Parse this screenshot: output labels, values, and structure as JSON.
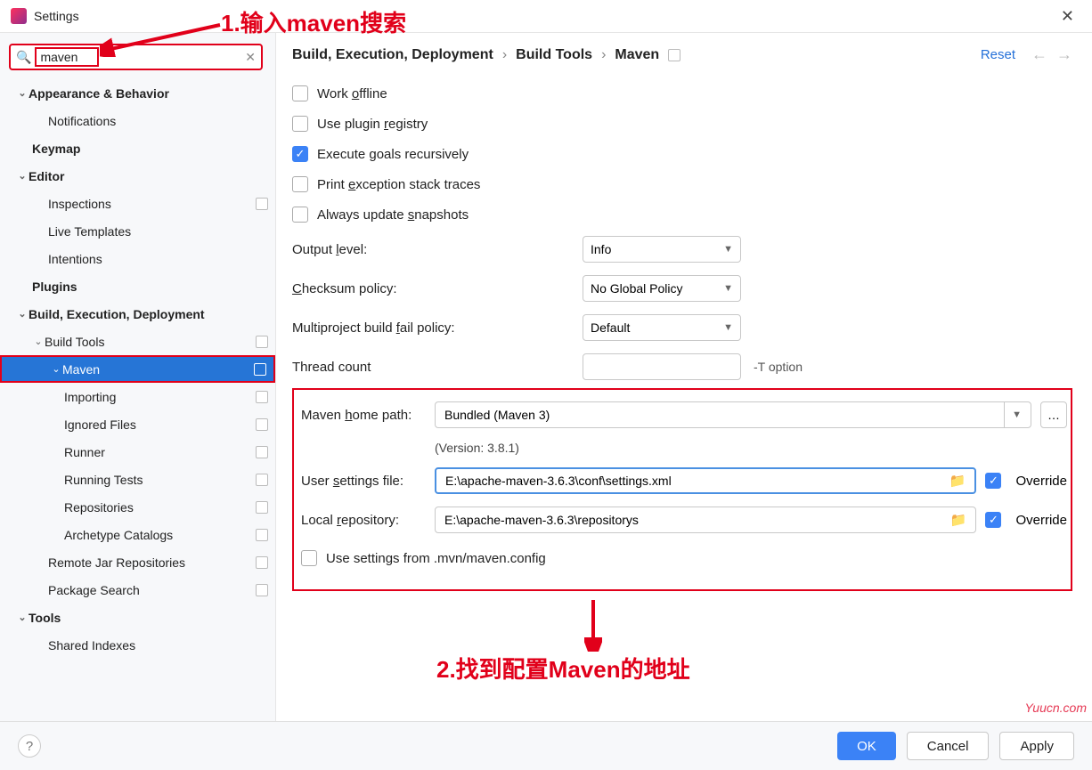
{
  "window": {
    "title": "Settings"
  },
  "search": {
    "value": "maven"
  },
  "sidebar": {
    "items": [
      {
        "label": "Appearance & Behavior"
      },
      {
        "label": "Notifications"
      },
      {
        "label": "Keymap"
      },
      {
        "label": "Editor"
      },
      {
        "label": "Inspections"
      },
      {
        "label": "Live Templates"
      },
      {
        "label": "Intentions"
      },
      {
        "label": "Plugins"
      },
      {
        "label": "Build, Execution, Deployment"
      },
      {
        "label": "Build Tools"
      },
      {
        "label": "Maven"
      },
      {
        "label": "Importing"
      },
      {
        "label": "Ignored Files"
      },
      {
        "label": "Runner"
      },
      {
        "label": "Running Tests"
      },
      {
        "label": "Repositories"
      },
      {
        "label": "Archetype Catalogs"
      },
      {
        "label": "Remote Jar Repositories"
      },
      {
        "label": "Package Search"
      },
      {
        "label": "Tools"
      },
      {
        "label": "Shared Indexes"
      }
    ]
  },
  "breadcrumb": {
    "a": "Build, Execution, Deployment",
    "b": "Build Tools",
    "c": "Maven"
  },
  "reset": "Reset",
  "checks": {
    "work_offline": "Work offline",
    "use_plugin_registry": "Use plugin registry",
    "execute_goals": "Execute goals recursively",
    "print_exception": "Print exception stack traces",
    "always_update": "Always update snapshots",
    "use_mvn_config": "Use settings from .mvn/maven.config"
  },
  "fields": {
    "output_level": {
      "label": "Output level:",
      "value": "Info"
    },
    "checksum": {
      "label": "Checksum policy:",
      "value": "No Global Policy"
    },
    "fail_policy": {
      "label": "Multiproject build fail policy:",
      "value": "Default"
    },
    "thread_count": {
      "label": "Thread count",
      "value": "",
      "hint": "-T option"
    },
    "home_path": {
      "label": "Maven home path:",
      "value": "Bundled (Maven 3)"
    },
    "version": "(Version: 3.8.1)",
    "user_settings": {
      "label": "User settings file:",
      "value": "E:\\apache-maven-3.6.3\\conf\\settings.xml"
    },
    "local_repo": {
      "label": "Local repository:",
      "value": "E:\\apache-maven-3.6.3\\repositorys"
    },
    "override": "Override"
  },
  "footer": {
    "ok": "OK",
    "cancel": "Cancel",
    "apply": "Apply"
  },
  "annotations": {
    "a1": "1.输入maven搜索",
    "a2": "2.找到配置Maven的地址"
  },
  "watermark": "Yuucn.com"
}
